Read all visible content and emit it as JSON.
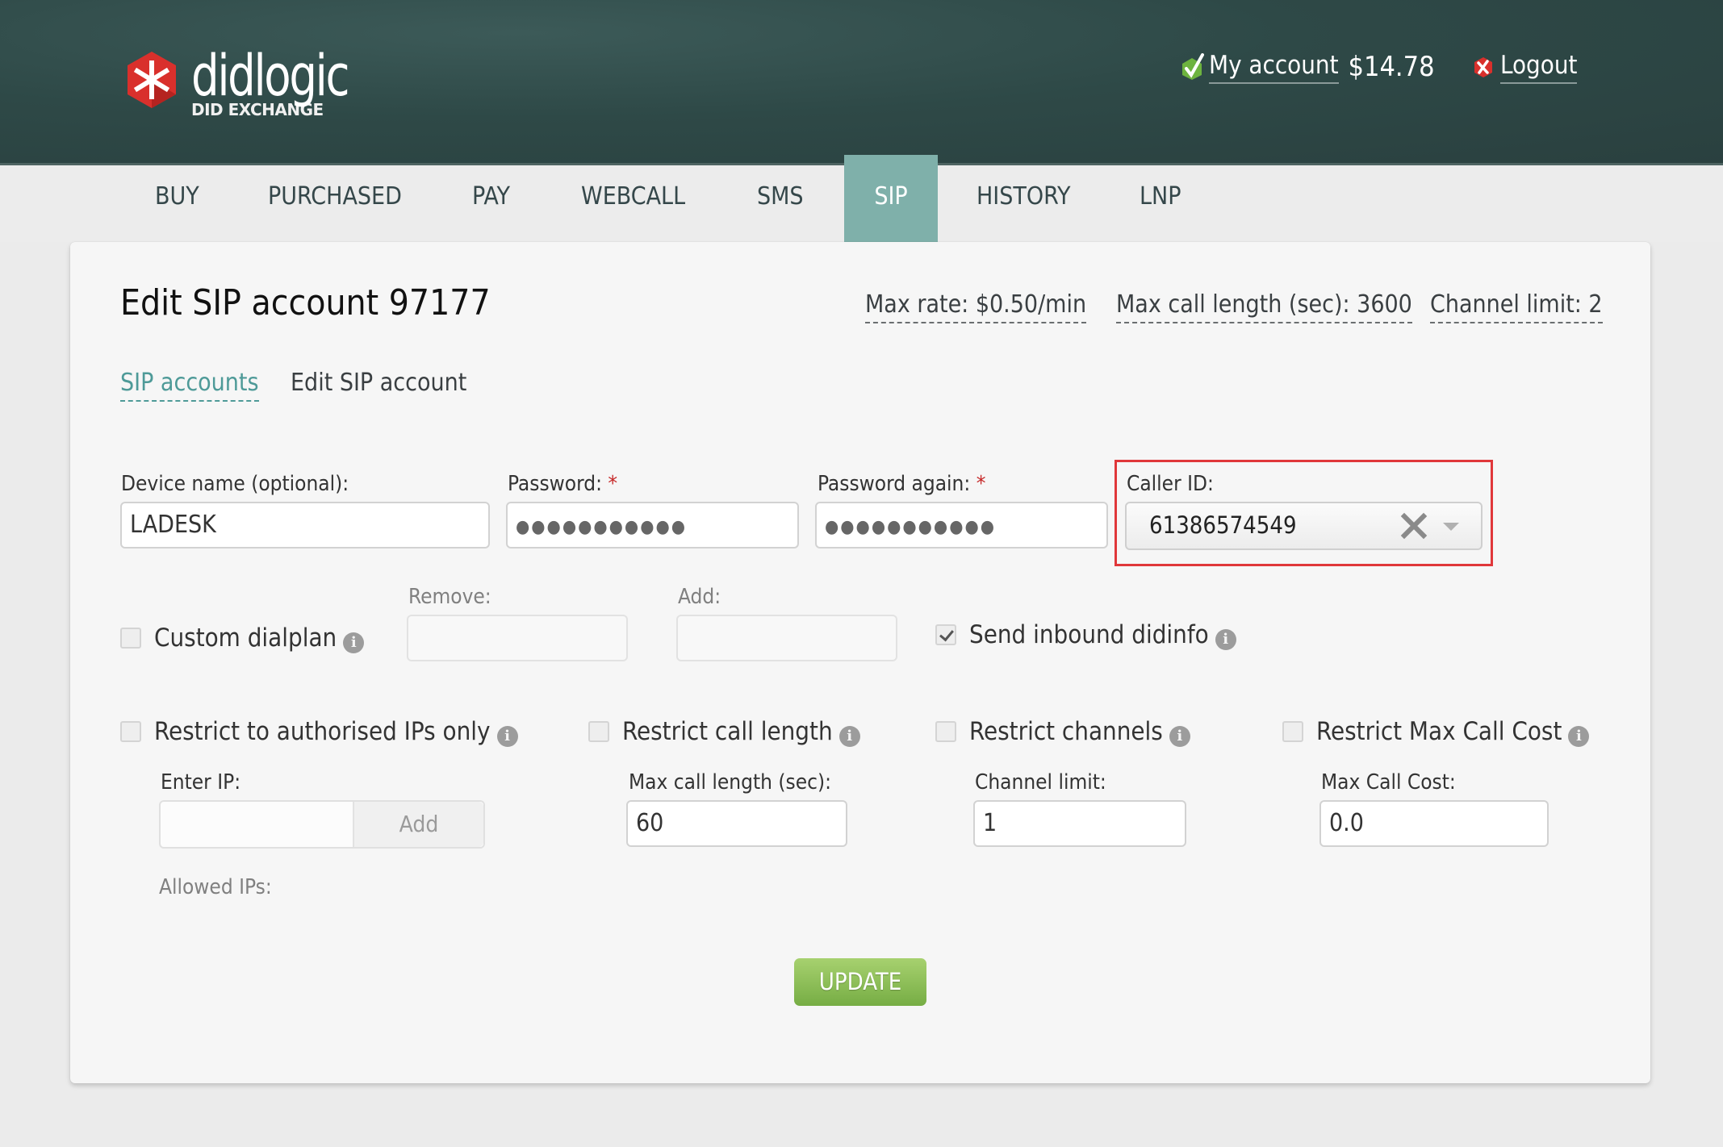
{
  "header": {
    "logo_name": "didlogic",
    "logo_sub": "DID EXCHANGE",
    "my_account_label": "My account",
    "balance": "$14.78",
    "logout_label": "Logout",
    "icons": {
      "account": "green-check-icon",
      "logout": "red-x-icon",
      "logo": "asterisk-hexagon-logo"
    }
  },
  "nav": {
    "items": [
      {
        "label": "BUY",
        "active": false
      },
      {
        "label": "PURCHASED",
        "active": false
      },
      {
        "label": "PAY",
        "active": false
      },
      {
        "label": "WEBCALL",
        "active": false
      },
      {
        "label": "SMS",
        "active": false
      },
      {
        "label": "SIP",
        "active": true
      },
      {
        "label": "HISTORY",
        "active": false
      },
      {
        "label": "LNP",
        "active": false
      }
    ],
    "active_color": "#7fb0aa"
  },
  "page": {
    "title": "Edit SIP account 97177",
    "stats": {
      "max_rate": "Max rate: $0.50/min",
      "max_call_length": "Max call length (sec): 3600",
      "channel_limit": "Channel limit: 2"
    },
    "breadcrumb": {
      "link": "SIP accounts",
      "current": "Edit SIP account"
    }
  },
  "form": {
    "device_name": {
      "label": "Device name (optional):",
      "value": "LADESK"
    },
    "password": {
      "label": "Password:",
      "required_mark": "*",
      "value": "●●●●●●●●●●●"
    },
    "password_again": {
      "label": "Password again:",
      "required_mark": "*",
      "value": "●●●●●●●●●●●"
    },
    "caller_id": {
      "label": "Caller ID:",
      "value": "61386574549"
    },
    "custom_dialplan": {
      "label": "Custom dialplan",
      "checked": false
    },
    "remove": {
      "label": "Remove:",
      "value": ""
    },
    "add": {
      "label": "Add:",
      "value": ""
    },
    "send_inbound_didinfo": {
      "label": "Send inbound didinfo",
      "checked": true
    },
    "restrict_ips": {
      "label": "Restrict to authorised IPs only",
      "checked": false
    },
    "enter_ip": {
      "label": "Enter IP:",
      "value": "",
      "add_button": "Add"
    },
    "allowed_ips_label": "Allowed IPs:",
    "restrict_call_length": {
      "label": "Restrict call length",
      "checked": false
    },
    "max_call_length": {
      "label": "Max call length (sec):",
      "value": "60"
    },
    "restrict_channels": {
      "label": "Restrict channels",
      "checked": false
    },
    "channel_limit": {
      "label": "Channel limit:",
      "value": "1"
    },
    "restrict_max_call_cost": {
      "label": "Restrict Max Call Cost",
      "checked": false
    },
    "max_call_cost": {
      "label": "Max Call Cost:",
      "value": "0.0"
    },
    "update_button": "UPDATE",
    "info_glyph": "i"
  },
  "colors": {
    "highlight_border": "#e0373a",
    "update_button": "#8cc05a",
    "link": "#4e9a98",
    "header_bg": "#2e4947"
  }
}
